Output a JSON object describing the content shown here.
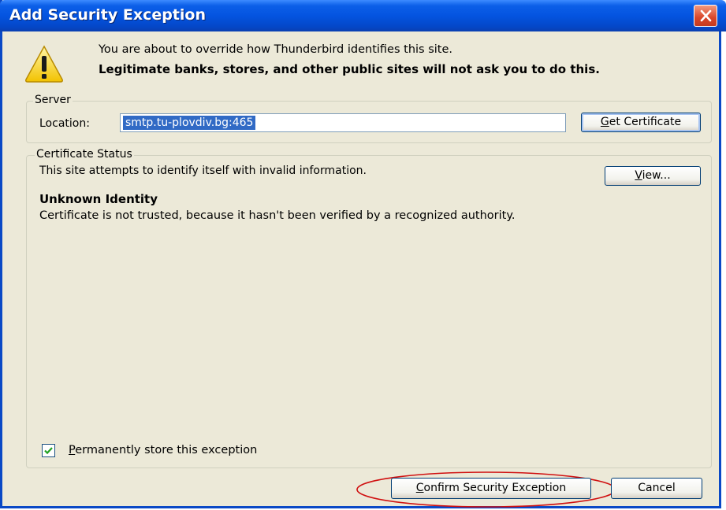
{
  "window": {
    "title": "Add Security Exception"
  },
  "warning": {
    "line1": "You are about to override how Thunderbird identifies this site.",
    "line2": "Legitimate banks, stores, and other public sites will not ask you to do this."
  },
  "server": {
    "group_label": "Server",
    "location_label": "Location:",
    "location_value": "smtp.tu-plovdiv.bg:465",
    "get_certificate": {
      "accesskey": "G",
      "rest": "et Certificate"
    }
  },
  "certificate_status": {
    "group_label": "Certificate Status",
    "message": "This site attempts to identify itself with invalid information.",
    "view": {
      "accesskey": "V",
      "rest": "iew..."
    },
    "identity_title": "Unknown Identity",
    "identity_desc": "Certificate is not trusted, because it hasn't been verified by a recognized authority."
  },
  "permanent": {
    "checked": true,
    "accesskey": "P",
    "rest": "ermanently store this exception"
  },
  "buttons": {
    "confirm": {
      "accesskey": "C",
      "rest": "onfirm Security Exception"
    },
    "cancel": "Cancel"
  },
  "colors": {
    "titlebar": "#0454e0",
    "dialog_bg": "#ece9d8",
    "highlight_ellipse": "#d01010"
  }
}
